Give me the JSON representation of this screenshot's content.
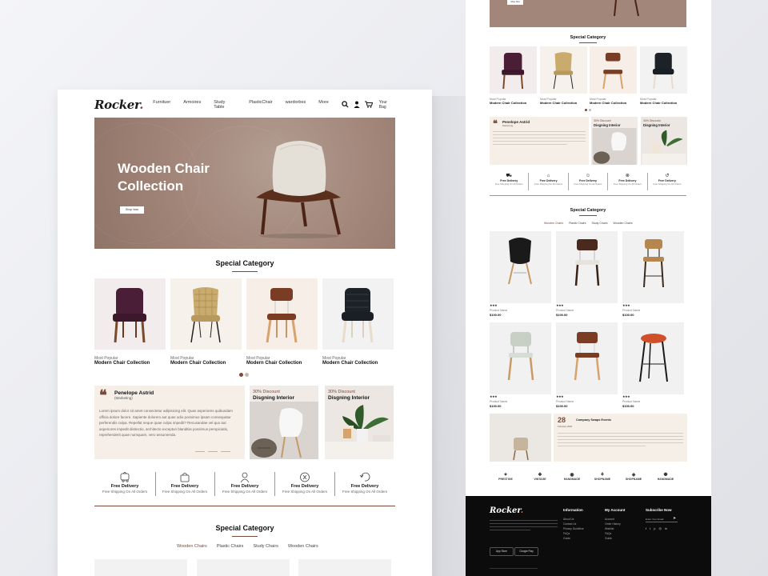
{
  "left": {
    "logo": "Rocker",
    "menu": [
      "Furnituer",
      "Armoires",
      "Study Table",
      "PlasticChair",
      "wardorbes",
      "More"
    ],
    "bag_label": "Your Bag",
    "hero": {
      "title": "Wooden Chair Collection",
      "button": "Shop Now"
    },
    "special1": {
      "title": "Special Category",
      "products": [
        {
          "sub": "Most Popular",
          "name": "Modern Chair Collection"
        },
        {
          "sub": "Most Popular",
          "name": "Modern Chair Collection"
        },
        {
          "sub": "Most Popular",
          "name": "Modern Chair Collection"
        },
        {
          "sub": "Most Popular",
          "name": "Modern Chair Collection"
        }
      ]
    },
    "testimonial": {
      "name": "Penelope Astrid",
      "role": "(Marketing)",
      "text": "Lorem ipsum dolor sit amet consectetur adipisicing elit. Quas asperiores quibusdam officia dolore facere. Sapiente dolorem aut quas odio possimus ipsam consequatur perferendis culpa. Repellat neque quae culpa impedit? Recusandae vel quo aut asperiores impedit distinctio, architecto excepturi blanditiis possimus perspiciatis, reprehenderit quae numquam, vero assumenda."
    },
    "promos": [
      {
        "discount": "30% Discount",
        "title": "Disgning Interior"
      },
      {
        "discount": "30% Discount",
        "title": "Disgning Interior"
      }
    ],
    "features": [
      {
        "title": "Free Delivery",
        "sub": "Free Shipping On All Orders"
      },
      {
        "title": "Free Delivery",
        "sub": "Free Shipping On All Orders"
      },
      {
        "title": "Free Delivery",
        "sub": "Free Shipping On All Orders"
      },
      {
        "title": "Free Delivery",
        "sub": "Free Shipping On All Orders"
      },
      {
        "title": "Free Delivery",
        "sub": "Free Shipping On All Orders"
      }
    ],
    "special2": {
      "title": "Special Category",
      "tabs": [
        "Wooden Chairs",
        "Plastic Chairs",
        "Study Chairs",
        "Wooden Chairs"
      ]
    }
  },
  "right": {
    "hero_button": "Shop Now",
    "special1": {
      "title": "Special Category",
      "products": [
        {
          "sub": "Most Popular",
          "name": "Modern Chair Collection"
        },
        {
          "sub": "Most Popular",
          "name": "Modern Chair Collection"
        },
        {
          "sub": "Most Popular",
          "name": "Modern Chair Collection"
        },
        {
          "sub": "Most Popular",
          "name": "Modern Chair Collection"
        }
      ]
    },
    "testimonial": {
      "name": "Penelope Astrid",
      "role": "Marketing"
    },
    "promos": [
      {
        "discount": "30% Discount",
        "title": "Disgning Interior"
      },
      {
        "discount": "30% Discount",
        "title": "Disgning Interior"
      }
    ],
    "features": [
      {
        "title": "Free Delivery",
        "sub": "Free Shipping On All Orders"
      },
      {
        "title": "Free Delivery",
        "sub": "Free Shipping On All Orders"
      },
      {
        "title": "Free Delivery",
        "sub": "Free Shipping On All Orders"
      },
      {
        "title": "Free Delivery",
        "sub": "Free Shipping On All Orders"
      },
      {
        "title": "Free Delivery",
        "sub": "Free Shipping On All Orders"
      }
    ],
    "special2": {
      "title": "Special Category",
      "tabs": [
        "Wooden Chairs",
        "Plastic Chairs",
        "Study Chairs",
        "Wooden Chairs"
      ],
      "grid": [
        {
          "stars": "★★★",
          "name": "Product Name",
          "price": "$100.00"
        },
        {
          "stars": "★★★",
          "name": "Product Name",
          "price": "$100.00"
        },
        {
          "stars": "★★★",
          "name": "Product Name",
          "price": "$100.00"
        },
        {
          "stars": "★★★",
          "name": "Product Name",
          "price": "$100.00"
        },
        {
          "stars": "★★★",
          "name": "Product Name",
          "price": "$100.00"
        },
        {
          "stars": "★★★",
          "name": "Product Name",
          "price": "$100.00"
        }
      ]
    },
    "event": {
      "day": "28",
      "month": "February 2020",
      "title": "Company Swaps Events"
    },
    "brands": [
      "PRESTIGE",
      "VINTAGE",
      "HANDMADE",
      "SHOPNAME",
      "SHOPNAME",
      "HANDMADE"
    ],
    "footer": {
      "logo": "Rocker",
      "cols": [
        {
          "head": "Information",
          "links": [
            "About Us",
            "Contact Us",
            "Privacy Guideline",
            "FAQs",
            "Guide"
          ]
        },
        {
          "head": "My Account",
          "links": [
            "Account",
            "Order History",
            "Wishlist",
            "FAQs",
            "Guide"
          ]
        }
      ],
      "subscribe": {
        "head": "Subscribe Now",
        "placeholder": "Enter Your Email"
      },
      "stores": [
        "App Store",
        "Google Play"
      ]
    }
  },
  "colors": {
    "accent": "#7a4a3a",
    "hero_bg": "#a28679",
    "footer_bg": "#0c0c0c"
  }
}
